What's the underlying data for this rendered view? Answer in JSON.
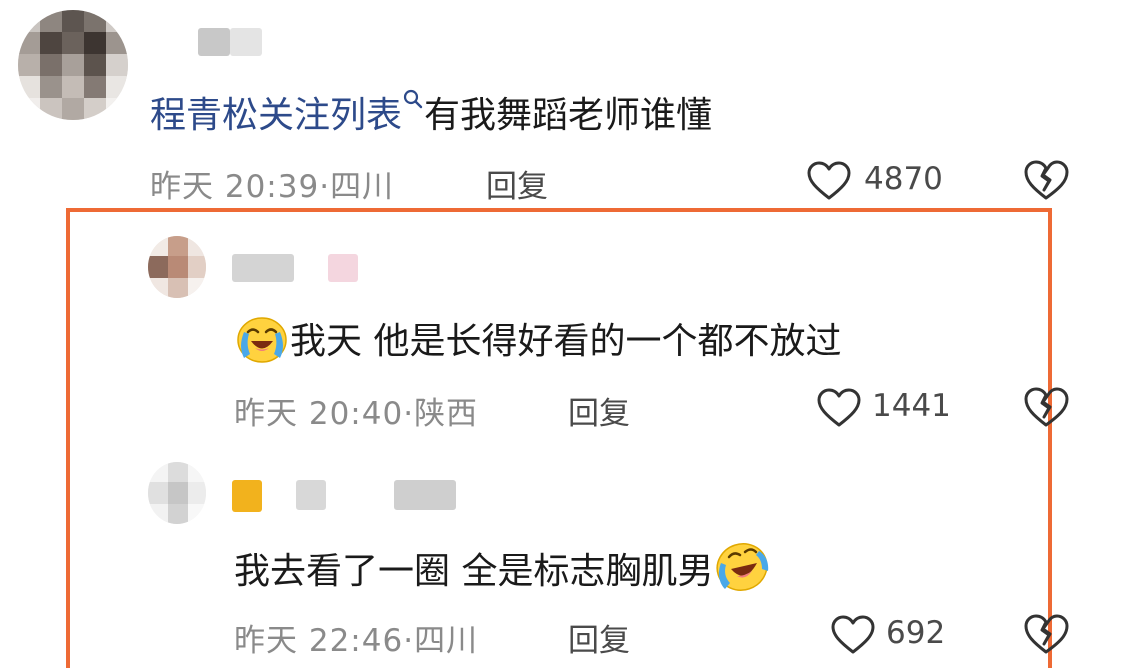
{
  "comments": [
    {
      "text_link": "程青松关注列表",
      "text_rest": "有我舞蹈老师谁懂",
      "time": "昨天 20:39",
      "location": "四川",
      "reply_label": "回复",
      "likes": "4870"
    },
    {
      "text": "我天 他是长得好看的一个都不放过",
      "time": "昨天 20:40",
      "location": "陕西",
      "reply_label": "回复",
      "likes": "1441"
    },
    {
      "text": "我去看了一圈 全是标志胸肌男",
      "time": "昨天 22:46",
      "location": "四川",
      "reply_label": "回复",
      "likes": "692"
    }
  ],
  "icons": {
    "like": "heart-outline",
    "dislike": "broken-heart-outline",
    "search": "magnifier",
    "emoji": "crying-laughing-face"
  },
  "colors": {
    "highlight_border": "#ee6a35",
    "link": "#2d4a8a",
    "meta": "#8a8a8a"
  }
}
